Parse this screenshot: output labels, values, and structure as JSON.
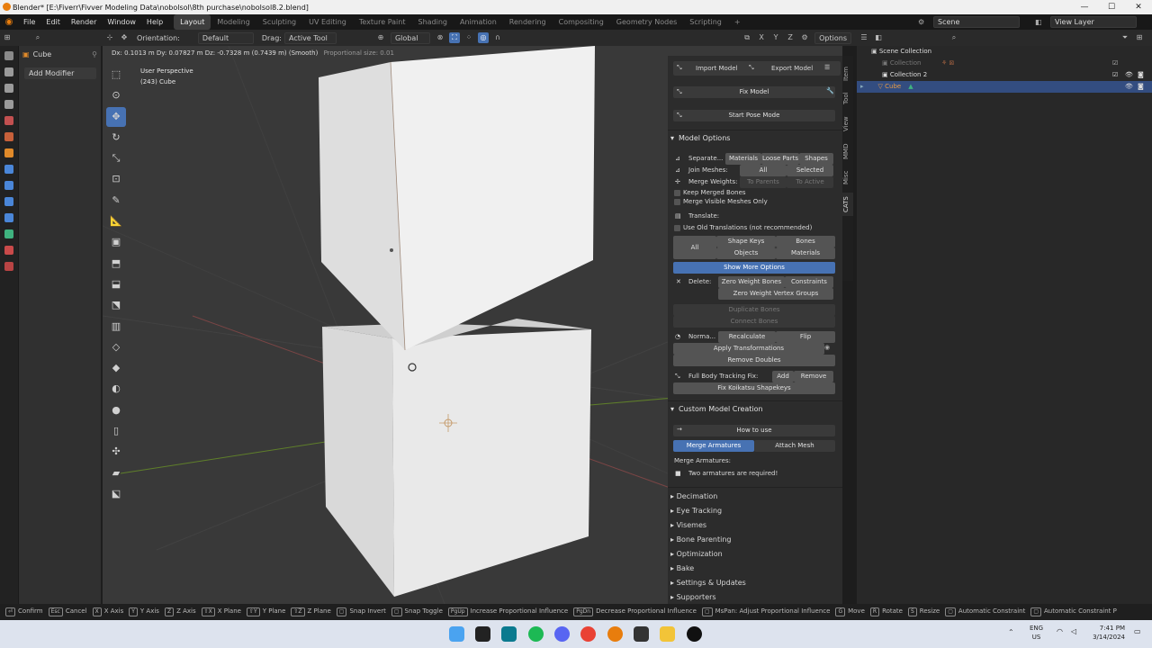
{
  "window": {
    "title": "Blender* [E:\\Fiverr\\Fivver Modeling Data\\nobolsol\\8th purchase\\nobolsol8.2.blend]",
    "minimize": "—",
    "maximize": "☐",
    "close": "✕"
  },
  "menu": [
    "File",
    "Edit",
    "Render",
    "Window",
    "Help"
  ],
  "workspaces": [
    "Layout",
    "Modeling",
    "Sculpting",
    "UV Editing",
    "Texture Paint",
    "Shading",
    "Animation",
    "Rendering",
    "Compositing",
    "Geometry Nodes",
    "Scripting"
  ],
  "add_workspace": "+",
  "scene": {
    "name": "Scene",
    "view_layer": "View Layer"
  },
  "properties": {
    "object_name": "Cube",
    "add_modifier": "Add Modifier"
  },
  "viewport_header": {
    "orientation_label": "Orientation:",
    "orientation_value": "Default",
    "drag_label": "Drag:",
    "drag_value": "Active Tool",
    "transform_orientation": "Global",
    "axes": [
      "X",
      "Y",
      "Z"
    ],
    "options": "Options"
  },
  "viewport": {
    "transform_readout": "Dx: 0.1013 m  Dy: 0.07827 m  Dz: -0.7328 m (0.7439 m) (Smooth)",
    "proportional": "Proportional size: 0.01",
    "view_name": "User Perspective",
    "object_info": "(243) Cube"
  },
  "cats": {
    "import_model": "Import Model",
    "export_model": "Export Model",
    "fix_model": "Fix Model",
    "start_pose_mode": "Start Pose Mode",
    "model_options": "Model Options",
    "separate_label": "Separate...",
    "separate_opts": [
      "Materials",
      "Loose Parts",
      "Shapes"
    ],
    "join_label": "Join Meshes:",
    "join_opts": [
      "All",
      "Selected"
    ],
    "merge_weights_label": "Merge Weights:",
    "merge_weights_opts": [
      "To Parents",
      "To Active"
    ],
    "keep_merged_bones": "Keep Merged Bones",
    "merge_visible_meshes": "Merge Visible Meshes Only",
    "translate_label": "Translate:",
    "use_old_translations": "Use Old Translations (not recommended)",
    "translate_all": "All",
    "translate_opts": [
      "Shape Keys",
      "Bones",
      "Objects",
      "Materials"
    ],
    "show_more_options": "Show More Options",
    "delete_label": "Delete:",
    "delete_opts": [
      "Zero Weight Bones",
      "Constraints",
      "Zero Weight Vertex Groups"
    ],
    "duplicate_bones": "Duplicate Bones",
    "connect_bones": "Connect Bones",
    "normals_label": "Norma...",
    "normals_opts": [
      "Recalculate",
      "Flip"
    ],
    "apply_transformations": "Apply Transformations",
    "remove_doubles": "Remove Doubles",
    "fbt_label": "Full Body Tracking Fix:",
    "fbt_opts": [
      "Add",
      "Remove"
    ],
    "fix_koikatsu": "Fix Koikatsu Shapekeys",
    "custom_model_creation": "Custom Model Creation",
    "how_to_use": "How to use",
    "merge_armatures_tab": "Merge Armatures",
    "attach_mesh_tab": "Attach Mesh",
    "merge_armatures_label": "Merge Armatures:",
    "two_armatures": "Two armatures are required!",
    "collapsed_sections": [
      "Decimation",
      "Eye Tracking",
      "Visemes",
      "Bone Parenting",
      "Optimization",
      "Bake",
      "Settings & Updates",
      "Supporters"
    ]
  },
  "sidebar_tabs": [
    "Item",
    "Tool",
    "View",
    "MMD",
    "Misc",
    "CATS"
  ],
  "outliner": {
    "rows": [
      "Scene Collection",
      "Collection",
      "Collection 2",
      "Cube"
    ]
  },
  "statusbar": [
    {
      "key": "⏎",
      "label": "Confirm"
    },
    {
      "key": "Esc",
      "label": "Cancel"
    },
    {
      "key": "X",
      "label": "X Axis"
    },
    {
      "key": "Y",
      "label": "Y Axis"
    },
    {
      "key": "Z",
      "label": "Z Axis"
    },
    {
      "key": "⇧X",
      "label": "X Plane"
    },
    {
      "key": "⇧Y",
      "label": "Y Plane"
    },
    {
      "key": "⇧Z",
      "label": "Z Plane"
    },
    {
      "key": "",
      "label": "Snap Invert"
    },
    {
      "key": "",
      "label": "Snap Toggle"
    },
    {
      "key": "PgUp",
      "label": "Increase Proportional Influence"
    },
    {
      "key": "PgDn",
      "label": "Decrease Proportional Influence"
    },
    {
      "key": "",
      "label": "MsPan: Adjust Proportional Influence"
    },
    {
      "key": "G",
      "label": "Move"
    },
    {
      "key": "R",
      "label": "Rotate"
    },
    {
      "key": "S",
      "label": "Resize"
    },
    {
      "key": "",
      "label": "Automatic Constraint"
    },
    {
      "key": "",
      "label": "Automatic Constraint P"
    }
  ],
  "taskbar": {
    "lang": "ENG",
    "region": "US",
    "time": "7:41 PM",
    "date": "3/14/2024"
  },
  "colors": {
    "accent": "#4772b3",
    "selected_row": "#334d80",
    "x_axis": "#9e3d3d",
    "y_axis": "#6a8f2a"
  }
}
